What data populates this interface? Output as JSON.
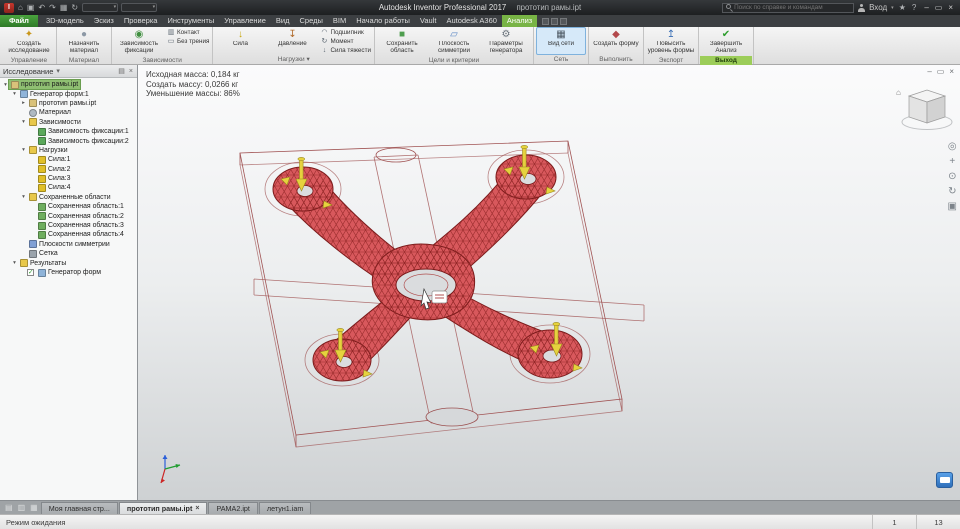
{
  "titlebar": {
    "app_title": "Autodesk Inventor Professional 2017",
    "doc_title": "прототип рамы.ipt",
    "search_placeholder": "Поиск по справке и командам",
    "signin": "Вход",
    "qat_icons": [
      "home-icon",
      "save-icon",
      "undo-icon",
      "redo-icon",
      "print-icon",
      "update-icon"
    ],
    "right_icons": [
      "star-icon",
      "help-icon"
    ],
    "window_icons": [
      "minimize-icon",
      "restore-icon",
      "close-icon"
    ]
  },
  "ribbon_tabs": [
    {
      "label": "Файл",
      "type": "file"
    },
    {
      "label": "3D-модель"
    },
    {
      "label": "Эскиз"
    },
    {
      "label": "Проверка"
    },
    {
      "label": "Инструменты"
    },
    {
      "label": "Управление"
    },
    {
      "label": "Вид"
    },
    {
      "label": "Среды"
    },
    {
      "label": "BIM"
    },
    {
      "label": "Начало работы"
    },
    {
      "label": "Vault"
    },
    {
      "label": "Autodesk A360"
    },
    {
      "label": "Анализ",
      "active": true
    }
  ],
  "ribbon_groups": [
    {
      "label": "Управление",
      "buttons": [
        {
          "label": "Создать исследование",
          "icon": "create-study",
          "size": "big"
        }
      ]
    },
    {
      "label": "Материал",
      "buttons": [
        {
          "label": "Назначить материал",
          "icon": "assign-material",
          "size": "big"
        }
      ]
    },
    {
      "label": "Зависимости",
      "buttons": [
        {
          "label": "Зависимость фиксации",
          "icon": "fix-constraint",
          "size": "big"
        },
        {
          "label": "Контакт",
          "icon": "contact",
          "size": "small"
        },
        {
          "label": "Без трения",
          "icon": "frictionless",
          "size": "small"
        }
      ]
    },
    {
      "label": "Нагрузки",
      "dropdown": true,
      "buttons": [
        {
          "label": "Сила",
          "icon": "force",
          "size": "big"
        },
        {
          "label": "Давление",
          "icon": "pressure",
          "size": "big"
        },
        {
          "label": "Подшипник",
          "icon": "bearing",
          "size": "small"
        },
        {
          "label": "Момент",
          "icon": "moment",
          "size": "small"
        },
        {
          "label": "Сила тяжести",
          "icon": "gravity",
          "size": "small"
        }
      ]
    },
    {
      "label": "Цели и критерии",
      "buttons": [
        {
          "label": "Сохранить область",
          "icon": "preserve-region",
          "size": "big"
        },
        {
          "label": "Плоскость симметрии",
          "icon": "symmetry-plane",
          "size": "big"
        },
        {
          "label": "Параметры генератора форм",
          "icon": "shapegen-settings",
          "size": "big"
        }
      ]
    },
    {
      "label": "Сеть",
      "buttons": [
        {
          "label": "Вид сети",
          "icon": "mesh-view",
          "size": "big",
          "active": true
        }
      ]
    },
    {
      "label": "Выполнить",
      "buttons": [
        {
          "label": "Создать форму",
          "icon": "create-form",
          "size": "big"
        }
      ]
    },
    {
      "label": "Экспорт",
      "buttons": [
        {
          "label": "Повысить уровень формы",
          "icon": "promote-form",
          "size": "big"
        }
      ]
    },
    {
      "label": "Выход",
      "accent": true,
      "buttons": [
        {
          "label": "Завершить Анализ",
          "icon": "finish-check",
          "size": "big"
        }
      ]
    }
  ],
  "browser": {
    "title": "Исследование",
    "tree": [
      {
        "label": "прототип рамы.ipt",
        "depth": 0,
        "icon": "part",
        "state": "open",
        "selected": true
      },
      {
        "label": "Генератор форм:1",
        "depth": 1,
        "icon": "study",
        "state": "open"
      },
      {
        "label": "прототип рамы.ipt",
        "depth": 2,
        "icon": "part",
        "state": "closed"
      },
      {
        "label": "Материал",
        "depth": 2,
        "icon": "material"
      },
      {
        "label": "Зависимости",
        "depth": 2,
        "icon": "constraints-folder",
        "state": "open"
      },
      {
        "label": "Зависимость фиксации:1",
        "depth": 3,
        "icon": "fix-constraint"
      },
      {
        "label": "Зависимость фиксации:2",
        "depth": 3,
        "icon": "fix-constraint"
      },
      {
        "label": "Нагрузки",
        "depth": 2,
        "icon": "loads-folder",
        "state": "open"
      },
      {
        "label": "Сила:1",
        "depth": 3,
        "icon": "force"
      },
      {
        "label": "Сила:2",
        "depth": 3,
        "icon": "force"
      },
      {
        "label": "Сила:3",
        "depth": 3,
        "icon": "force"
      },
      {
        "label": "Сила:4",
        "depth": 3,
        "icon": "force"
      },
      {
        "label": "Сохраненные области",
        "depth": 2,
        "icon": "regions-folder",
        "state": "open"
      },
      {
        "label": "Сохраненная область:1",
        "depth": 3,
        "icon": "preserve-region"
      },
      {
        "label": "Сохраненная область:2",
        "depth": 3,
        "icon": "preserve-region"
      },
      {
        "label": "Сохраненная область:3",
        "depth": 3,
        "icon": "preserve-region"
      },
      {
        "label": "Сохраненная область:4",
        "depth": 3,
        "icon": "preserve-region"
      },
      {
        "label": "Плоскости симметрии",
        "depth": 2,
        "icon": "symmetry-plane"
      },
      {
        "label": "Сетка",
        "depth": 2,
        "icon": "mesh"
      },
      {
        "label": "Результаты",
        "depth": 1,
        "icon": "results-folder",
        "state": "open"
      },
      {
        "label": "Генератор форм",
        "depth": 2,
        "icon": "shapegen-result",
        "checkbox": true,
        "checked": true
      }
    ]
  },
  "viewport": {
    "mass_lines": [
      "Исходная масса: 0,184 кг",
      "Создать массу: 0,0266 кг",
      "Уменьшение массы: 86%"
    ],
    "nav_icons": [
      "navigation-wheel-icon",
      "pan-icon",
      "zoom-icon",
      "orbit-icon",
      "look-at-icon"
    ],
    "doc_window_icons": [
      "minimize-doc-icon",
      "restore-doc-icon",
      "close-doc-icon"
    ]
  },
  "doc_tabs": [
    {
      "label": "Моя главная стр..."
    },
    {
      "label": "прототип рамы.ipt",
      "active": true,
      "closable": true
    },
    {
      "label": "РАМА2.ipt"
    },
    {
      "label": "летун1.iam"
    }
  ],
  "doc_tab_bar_icons": [
    "cascade-windows-icon",
    "tile-windows-icon",
    "switch-windows-icon"
  ],
  "statusbar": {
    "left": "Режим ожидания",
    "cells": [
      "1",
      "13"
    ]
  },
  "colors": {
    "accent_green": "#78b445",
    "selection_green": "#8fbf72",
    "mesh_red": "#d8585c",
    "mesh_edge": "#7a1a1a",
    "pin_yellow": "#e6d23e",
    "active_tool_blue": "#d6e9f9"
  }
}
